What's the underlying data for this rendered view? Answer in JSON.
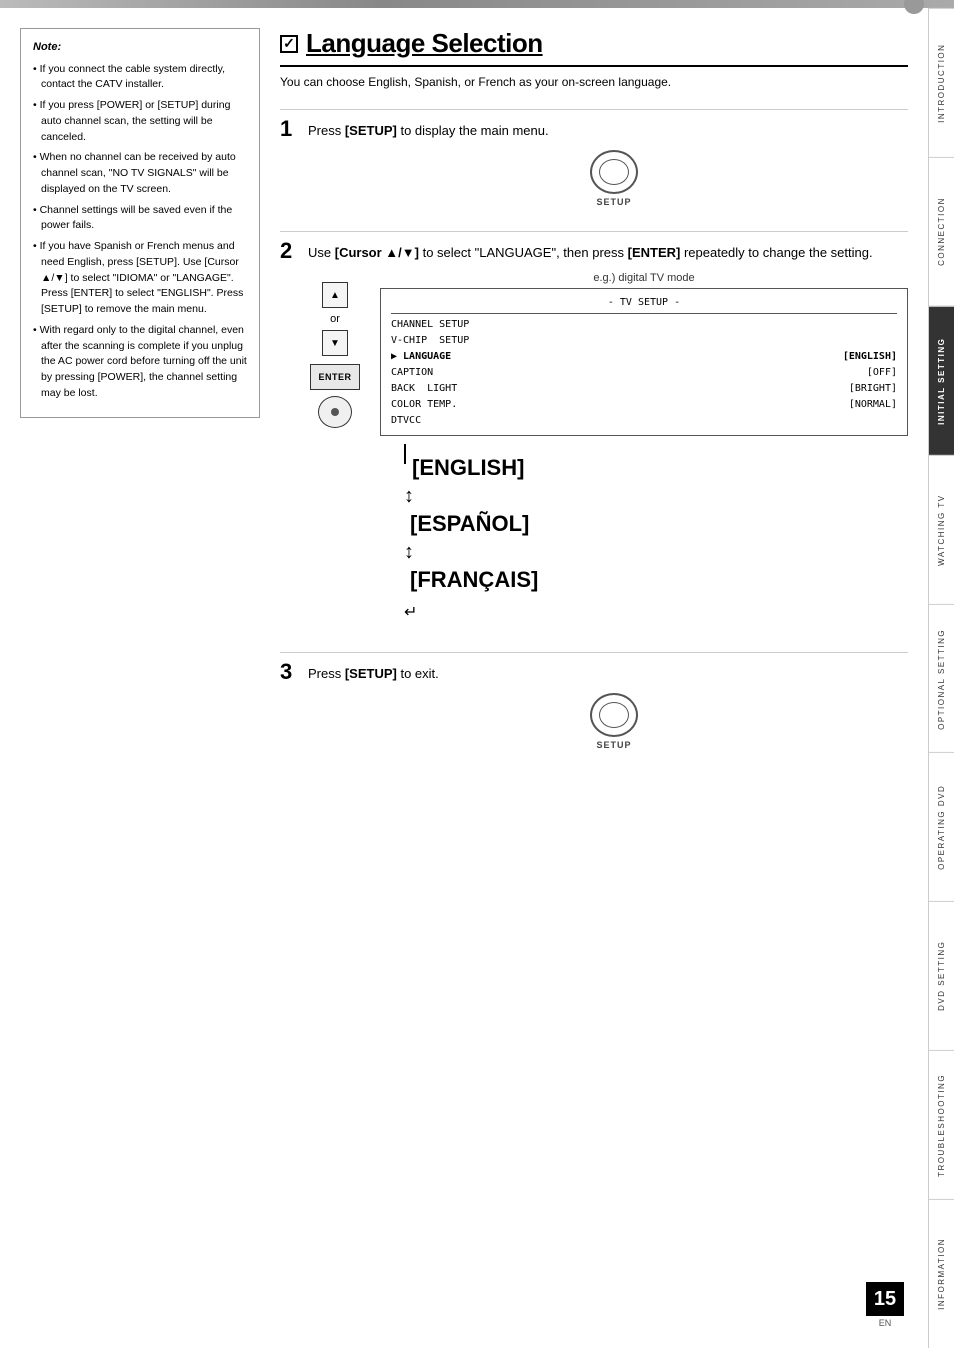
{
  "page": {
    "title": "Language Selection",
    "page_number": "15",
    "page_en": "EN"
  },
  "note": {
    "title": "Note:",
    "items": [
      "If you connect the cable system directly, contact the CATV installer.",
      "If you press [POWER] or [SETUP] during auto channel scan, the setting will be canceled.",
      "When no channel can be received by auto channel scan, \"NO TV SIGNALS\" will be displayed on the TV screen.",
      "Channel settings will be saved even if the power fails.",
      "If you have Spanish or French menus and need English, press [SETUP]. Use [Cursor ▲/▼] to select \"IDIOMA\" or \"LANGAGE\". Press [ENTER] to select \"ENGLISH\". Press [SETUP] to remove the main menu.",
      "With regard only to the digital channel, even after the scanning is complete if you unplug the AC power cord before turning off the unit by pressing [POWER], the channel setting may be lost."
    ]
  },
  "subtitle": "You can choose English, Spanish, or French as your on-screen language.",
  "steps": [
    {
      "number": "1",
      "text": "Press [SETUP] to display the main menu.",
      "button_label": "SETUP"
    },
    {
      "number": "2",
      "text": "Use [Cursor ▲/▼] to select \"LANGUAGE\", then press [ENTER] repeatedly to change the setting.",
      "eg_label": "e.g.) digital TV mode",
      "tv_menu": {
        "title": "- TV SETUP -",
        "rows": [
          {
            "label": "CHANNEL SETUP",
            "value": ""
          },
          {
            "label": "V-CHIP  SETUP",
            "value": ""
          },
          {
            "label": "▶ LANGUAGE",
            "value": "[ENGLISH]"
          },
          {
            "label": "CAPTION",
            "value": "[OFF]"
          },
          {
            "label": "BACK  LIGHT",
            "value": "[BRIGHT]"
          },
          {
            "label": "COLOR TEMP.",
            "value": "[NORMAL]"
          },
          {
            "label": "DTVCC",
            "value": ""
          }
        ]
      },
      "languages": [
        "[ENGLISH]",
        "[ESPAÑOL]",
        "[FRANÇAIS]"
      ]
    },
    {
      "number": "3",
      "text": "Press [SETUP] to exit.",
      "button_label": "SETUP"
    }
  ],
  "sidebar": {
    "tabs": [
      {
        "label": "INTRODUCTION",
        "active": false
      },
      {
        "label": "CONNECTION",
        "active": false
      },
      {
        "label": "INITIAL SETTING",
        "active": true
      },
      {
        "label": "WATCHING TV",
        "active": false
      },
      {
        "label": "OPTIONAL SETTING",
        "active": false
      },
      {
        "label": "OPERATING DVD",
        "active": false
      },
      {
        "label": "DVD SETTING",
        "active": false
      },
      {
        "label": "TROUBLESHOOTING",
        "active": false
      },
      {
        "label": "INFORMATION",
        "active": false
      }
    ]
  }
}
